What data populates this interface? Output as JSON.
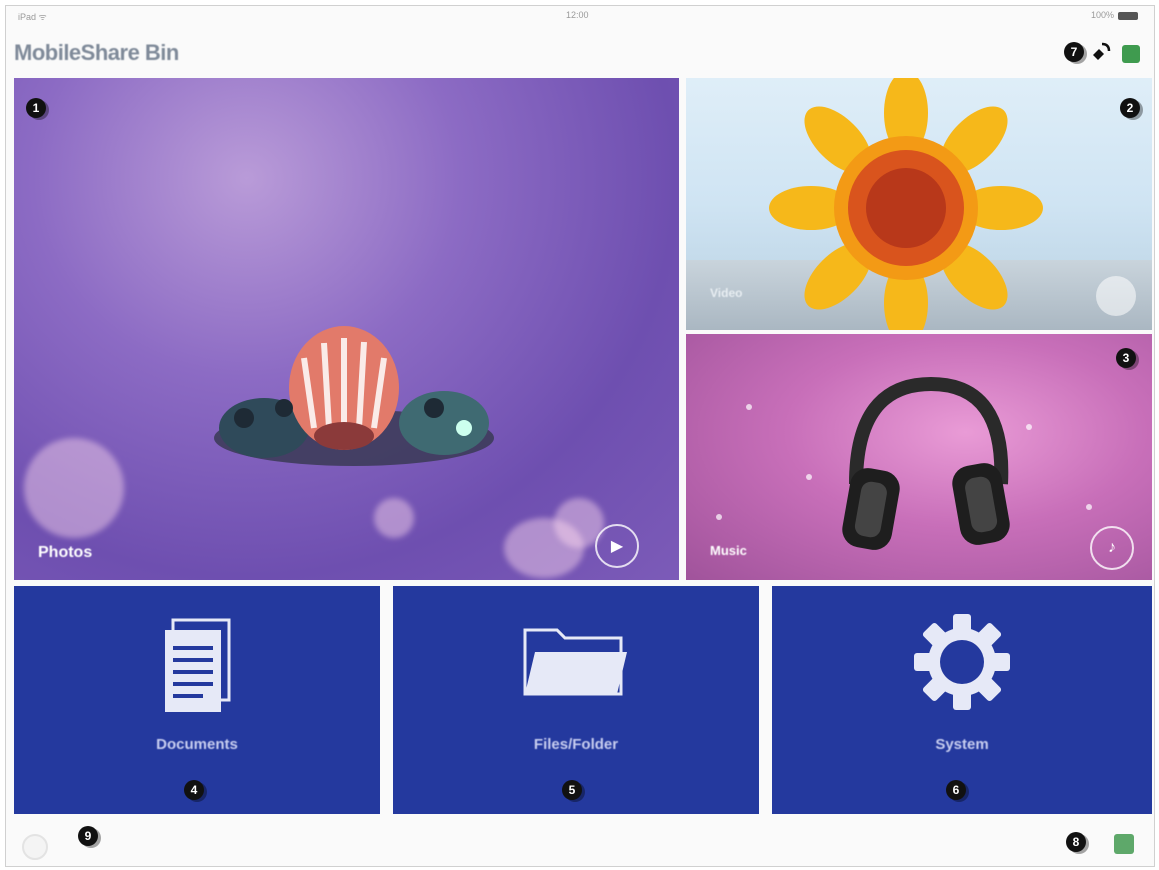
{
  "status_bar": {
    "left": "iPad ᯤ",
    "center": "12:00",
    "right": "100%"
  },
  "app": {
    "title": "MobileShare Bin"
  },
  "tiles": {
    "photos": {
      "label": "Photos"
    },
    "videos": {
      "label": "Video"
    },
    "music": {
      "label": "Music"
    },
    "documents": {
      "label": "Documents"
    },
    "files": {
      "label": "Files/Folder"
    },
    "system": {
      "label": "System"
    }
  },
  "badges": {
    "b1": "1",
    "b2": "2",
    "b3": "3",
    "b4": "4",
    "b5": "5",
    "b6": "6",
    "b7": "7",
    "b8": "8",
    "b9": "9"
  },
  "colors": {
    "tile_blue": "#24399e",
    "photos_purple": "#7c5bb8",
    "music_pink": "#c86fb9",
    "accent_green": "#3f9b4f"
  },
  "icons": {
    "documents": "document-stack-icon",
    "files": "folder-icon",
    "system": "gear-icon",
    "play": "play-icon",
    "connect": "connect-icon",
    "refresh": "refresh-icon"
  }
}
